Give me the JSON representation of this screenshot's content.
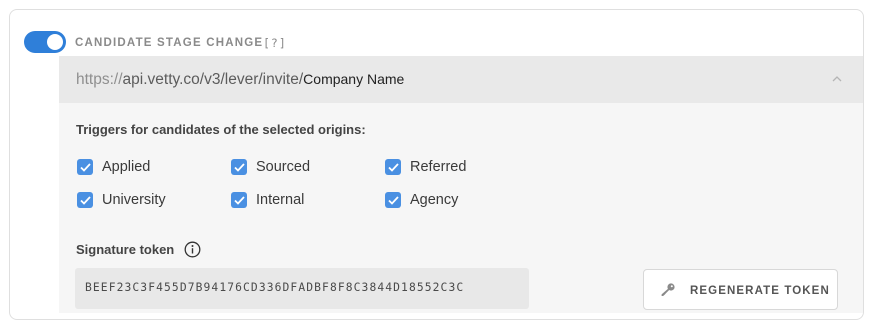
{
  "webhook": {
    "enabled": true,
    "title": "CANDIDATE STAGE CHANGE",
    "help_label": "[?]",
    "url": {
      "protocol": "https://",
      "path": "api.vetty.co/v3/lever/invite/",
      "company": "Company Name"
    },
    "collapse_icon": "chevron-up-icon",
    "triggers_label": "Triggers for candidates of the selected origins:",
    "origins": [
      {
        "label": "Applied",
        "checked": true
      },
      {
        "label": "Sourced",
        "checked": true
      },
      {
        "label": "Referred",
        "checked": true
      },
      {
        "label": "University",
        "checked": true
      },
      {
        "label": "Internal",
        "checked": true
      },
      {
        "label": "Agency",
        "checked": true
      }
    ],
    "signature_label": "Signature token",
    "info_icon": "info-icon",
    "token": "BEEF23C3F455D7B94176CD336DFADBF8F8C3844D18552C3C",
    "regenerate_label": "REGENERATE TOKEN",
    "regenerate_icon": "key-icon"
  },
  "colors": {
    "accent": "#2f7fd9",
    "checkbox": "#4a90e2",
    "url_bar_bg": "#e9e9e9",
    "panel_bg": "#f6f6f6"
  }
}
